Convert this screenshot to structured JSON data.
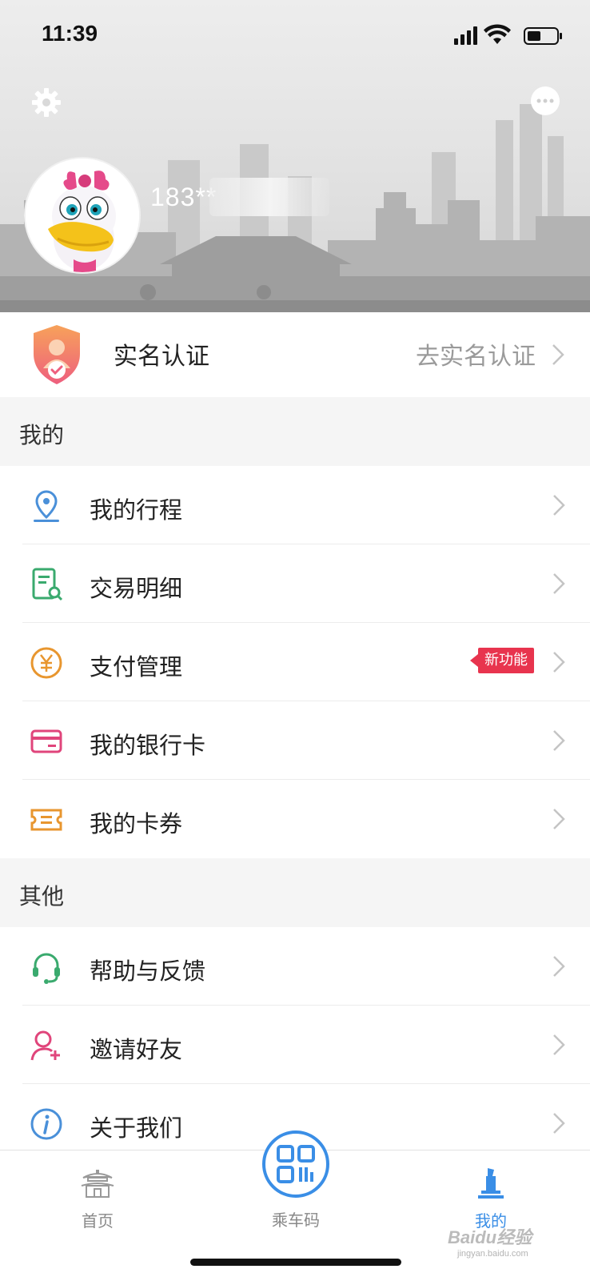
{
  "status_bar": {
    "time": "11:39"
  },
  "profile": {
    "phone": "183**"
  },
  "realname": {
    "title": "实名认证",
    "action": "去实名认证"
  },
  "sections": {
    "mine": "我的",
    "other": "其他"
  },
  "menu_mine": [
    {
      "label": "我的行程",
      "icon": "location-pin-icon",
      "color": "#4a90d9"
    },
    {
      "label": "交易明细",
      "icon": "receipt-search-icon",
      "color": "#3aaa6e"
    },
    {
      "label": "支付管理",
      "icon": "yuan-coin-icon",
      "color": "#e8962f",
      "badge": "新功能"
    },
    {
      "label": "我的银行卡",
      "icon": "bank-card-icon",
      "color": "#e0457b"
    },
    {
      "label": "我的卡券",
      "icon": "coupon-icon",
      "color": "#e8962f"
    }
  ],
  "menu_other": [
    {
      "label": "帮助与反馈",
      "icon": "headset-icon",
      "color": "#3aaa6e"
    },
    {
      "label": "邀请好友",
      "icon": "add-friend-icon",
      "color": "#e0457b"
    },
    {
      "label": "关于我们",
      "icon": "info-icon",
      "color": "#4a90d9"
    }
  ],
  "tabbar": {
    "home": "首页",
    "ride_code": "乘车码",
    "mine": "我的"
  },
  "watermark": {
    "brand": "Baidu经验",
    "url": "jingyan.baidu.com"
  },
  "colors": {
    "accent": "#3a8ee6",
    "badge": "#e8344e"
  }
}
